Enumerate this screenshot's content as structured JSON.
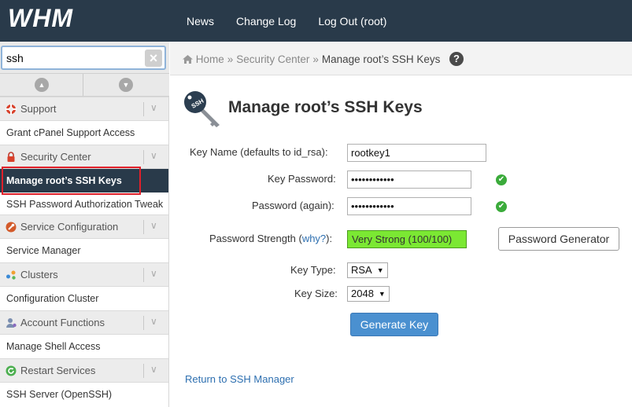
{
  "app": {
    "logo_text": "WHM"
  },
  "topnav": {
    "items": [
      "News",
      "Change Log",
      "Log Out (root)"
    ]
  },
  "sidebar": {
    "search": {
      "value": "ssh"
    },
    "groups": [
      {
        "label": "Support",
        "icon": "lifebuoy-icon",
        "items": [
          "Grant cPanel Support Access"
        ]
      },
      {
        "label": "Security Center",
        "icon": "lock-icon",
        "items": [
          "Manage root’s SSH Keys",
          "SSH Password Authorization Tweak"
        ]
      },
      {
        "label": "Service Configuration",
        "icon": "wrench-icon",
        "items": [
          "Service Manager"
        ]
      },
      {
        "label": "Clusters",
        "icon": "clusters-icon",
        "items": [
          "Configuration Cluster"
        ]
      },
      {
        "label": "Account Functions",
        "icon": "user-icon",
        "items": [
          "Manage Shell Access"
        ]
      },
      {
        "label": "Restart Services",
        "icon": "restart-icon",
        "items": [
          "SSH Server (OpenSSH)"
        ]
      }
    ],
    "active_item": "Manage root’s SSH Keys",
    "highlight_color": "#e0202a"
  },
  "breadcrumb": {
    "home": "Home",
    "section": "Security Center",
    "current": "Manage root’s SSH Keys",
    "separator": "»"
  },
  "page": {
    "title": "Manage root’s SSH Keys",
    "form": {
      "key_name_label": "Key Name (defaults to id_rsa):",
      "key_name_value": "rootkey1",
      "key_password_label": "Key Password:",
      "key_password_value": "••••••••••••",
      "password_again_label": "Password (again):",
      "password_again_value": "••••••••••••",
      "strength_label": "Password Strength",
      "strength_why": "why?",
      "strength_value": "Very Strong (100/100)",
      "password_generator": "Password Generator",
      "key_type_label": "Key Type:",
      "key_type_value": "RSA",
      "key_size_label": "Key Size:",
      "key_size_value": "2048",
      "generate_button": "Generate Key"
    },
    "return_link": "Return to SSH Manager"
  },
  "colors": {
    "topbar": "#293a4a",
    "strength_fill": "#7be833",
    "primary_button": "#4a90d0",
    "link": "#2d6fb0",
    "check": "#3bab3b"
  }
}
